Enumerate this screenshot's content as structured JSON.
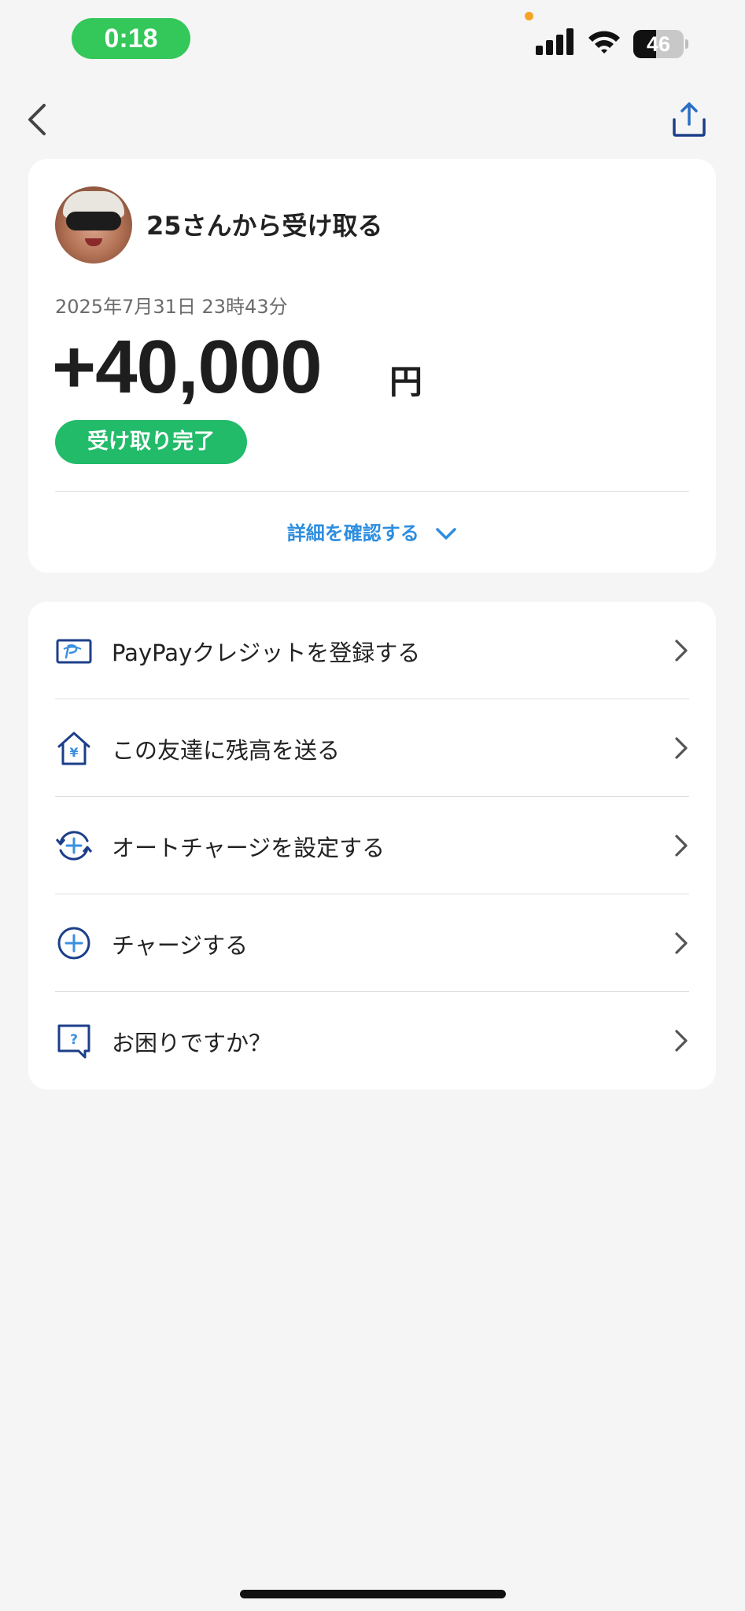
{
  "status_bar": {
    "time": "0:18",
    "battery_level": 46,
    "battery_text": "46",
    "icons": [
      "signal-icon",
      "wifi-icon",
      "battery-icon"
    ]
  },
  "nav": {
    "back_icon": "chevron-left-icon",
    "share_icon": "share-icon"
  },
  "receive": {
    "title": "25さんから受け取る",
    "datetime": "2025年7月31日 23時43分",
    "amount": "+40,000",
    "unit": "円",
    "status": "受け取り完了",
    "details_link": "詳細を確認する"
  },
  "menu": [
    {
      "icon": "paypay-credit-card-icon",
      "label": "PayPayクレジットを登録する"
    },
    {
      "icon": "house-yen-icon",
      "label": "この友達に残高を送る"
    },
    {
      "icon": "auto-charge-icon",
      "label": "オートチャージを設定する"
    },
    {
      "icon": "plus-circle-icon",
      "label": "チャージする"
    },
    {
      "icon": "help-bubble-icon",
      "label": "お困りですか？"
    }
  ],
  "colors": {
    "accent_green": "#22bb6a",
    "status_pill_green": "#34c759",
    "link_blue": "#2d8ee0",
    "icon_navy": "#1c3f8a",
    "background": "#f5f5f5"
  }
}
